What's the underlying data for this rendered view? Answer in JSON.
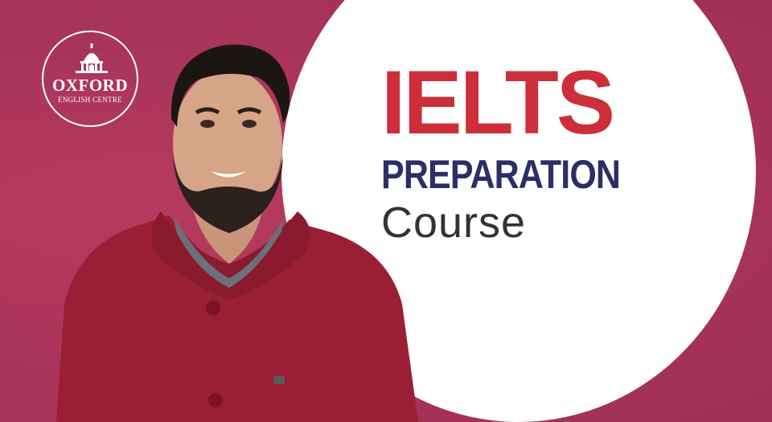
{
  "logo": {
    "name": "OXFORD",
    "subtitle": "ENGLISH CENTRE",
    "icon": "dome-building-icon"
  },
  "headline": {
    "title": "IELTS",
    "subtitle": "PREPARATION",
    "subtitle2": "Course"
  },
  "colors": {
    "background": "#b0375a",
    "title": "#cc2f3a",
    "subtitle": "#2c2f66",
    "subtitle2": "#333333",
    "sweater": "#9a1f35"
  },
  "person": {
    "icon": "presenter-photo"
  }
}
